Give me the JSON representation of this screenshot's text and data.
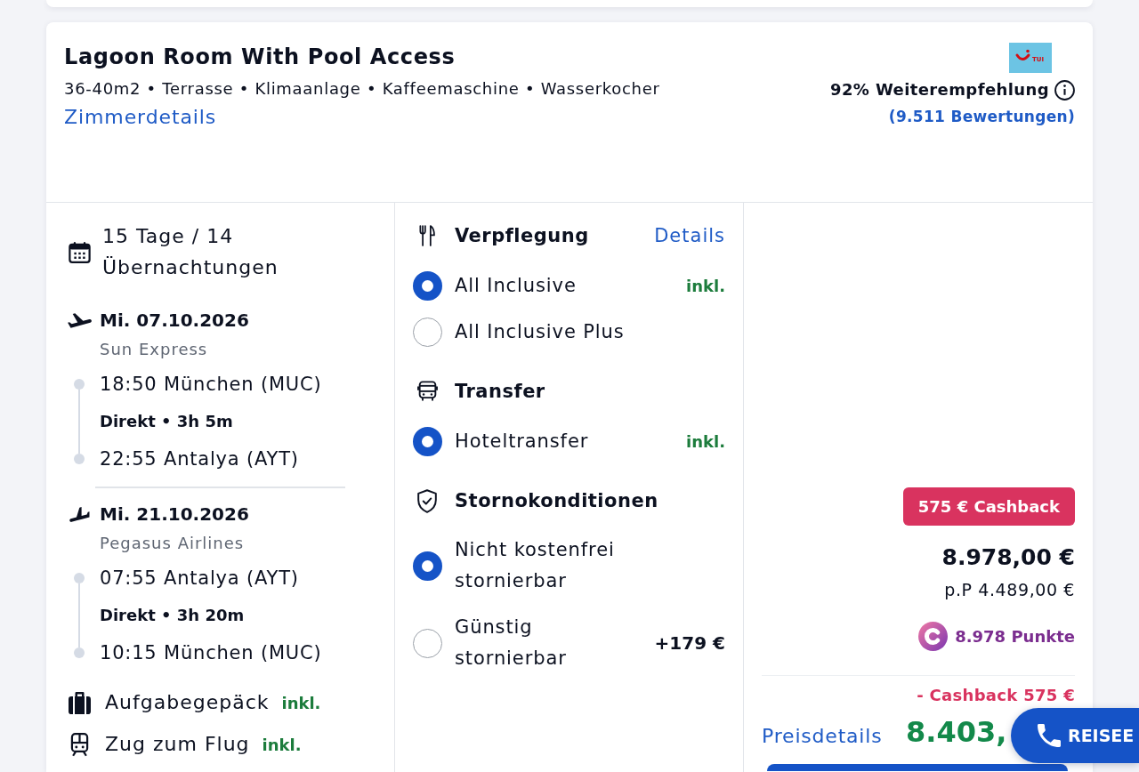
{
  "room": {
    "title": "Lagoon Room With Pool Access",
    "features": "36-40m2 • Terrasse • Klimaanlage • Kaffeemaschine • Wasserkocher",
    "details_link": "Zimmerdetails"
  },
  "operator": {
    "logo_text": "TUI",
    "recommendation": "92% Weiterempfehlung",
    "reviews_link": "(9.511 Bewertungen)"
  },
  "trip": {
    "duration": "15 Tage / 14 Übernachtungen",
    "flights": [
      {
        "kind": "outbound",
        "date": "Mi. 07.10.2026",
        "airline": "Sun Express",
        "departure": "18:50 München (MUC)",
        "connection": "Direkt • 3h 5m",
        "arrival": "22:55 Antalya (AYT)"
      },
      {
        "kind": "return",
        "date": "Mi. 21.10.2026",
        "airline": "Pegasus Airlines",
        "departure": "07:55 Antalya (AYT)",
        "connection": "Direkt • 3h 20m",
        "arrival": "10:15 München (MUC)"
      }
    ],
    "extras": [
      {
        "kind": "baggage",
        "label": "Aufgabegepäck",
        "status": "inkl."
      },
      {
        "kind": "train",
        "label": "Zug zum Flug",
        "status": "inkl."
      }
    ]
  },
  "options": [
    {
      "kind": "board",
      "title": "Verpflegung",
      "link": "Details",
      "choices": [
        {
          "label": "All Inclusive",
          "price": {
            "text": "inkl.",
            "kind": "included"
          },
          "selected": true
        },
        {
          "label": "All Inclusive Plus",
          "selected": false
        }
      ]
    },
    {
      "kind": "transfer",
      "title": "Transfer",
      "choices": [
        {
          "label": "Hoteltransfer",
          "price": {
            "text": "inkl.",
            "kind": "included"
          },
          "selected": true
        }
      ]
    },
    {
      "kind": "cancellation",
      "title": "Stornokonditionen",
      "choices": [
        {
          "label": "Nicht kostenfrei stornierbar",
          "selected": true
        },
        {
          "label": "Günstig stornierbar",
          "price": {
            "text": "+179 €",
            "kind": "surcharge"
          },
          "selected": false
        }
      ]
    }
  ],
  "price": {
    "cashback_badge": "575 € Cashback",
    "total": "8.978,00 €",
    "per_person": "p.P 4.489,00 €",
    "points": "8.978 Punkte",
    "cashback_deduction": "- Cashback 575 €",
    "details_link": "Preisdetails",
    "final": "8.403,"
  },
  "call_button": {
    "label": "REISEE"
  }
}
